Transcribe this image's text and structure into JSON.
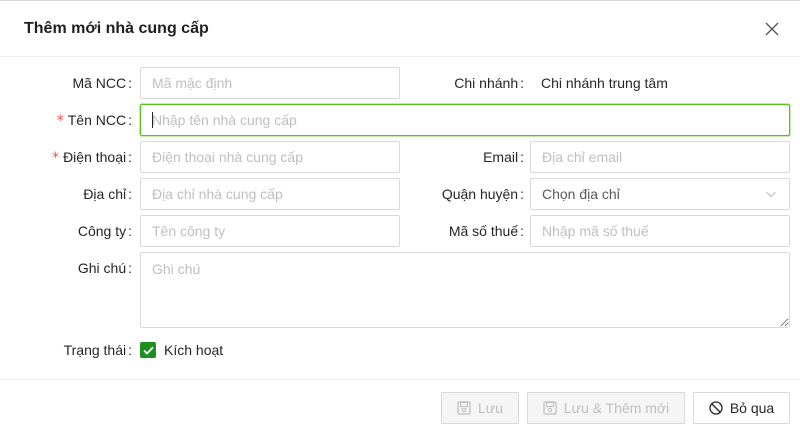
{
  "dialog": {
    "title": "Thêm mới nhà cung cấp"
  },
  "form": {
    "code": {
      "label": "Mã NCC",
      "placeholder": "Mã mặc định"
    },
    "branch": {
      "label": "Chi nhánh",
      "value": "Chi nhánh trung tâm"
    },
    "name": {
      "label": "Tên NCC",
      "required": "*",
      "placeholder": "Nhập tên nhà cung cấp"
    },
    "phone": {
      "label": "Điện thoại",
      "required": "*",
      "placeholder": "Điện thoại nhà cung cấp"
    },
    "email": {
      "label": "Email",
      "placeholder": "Địa chỉ email"
    },
    "address": {
      "label": "Địa chỉ",
      "placeholder": "Địa chỉ nhà cung cấp"
    },
    "district": {
      "label": "Quận huyện",
      "selected": "Chọn địa chỉ"
    },
    "company": {
      "label": "Công ty",
      "placeholder": "Tên công ty"
    },
    "tax": {
      "label": "Mã số thuế",
      "placeholder": "Nhập mã số thuế"
    },
    "note": {
      "label": "Ghi chú",
      "placeholder": "Ghi chú"
    },
    "status": {
      "label": "Trạng thái",
      "checkbox_label": "Kích hoạt",
      "checked": true
    }
  },
  "footer": {
    "save_label": "Lưu",
    "save_new_label": "Lưu & Thêm mới",
    "cancel_label": "Bỏ qua"
  },
  "icons": {
    "close": "close-icon",
    "save": "floppy-disk-icon",
    "cancel": "stop-circle-icon",
    "dropdown": "chevron-down-icon"
  },
  "colors": {
    "accent": "#1f8e1f",
    "focus_border": "#52c41a",
    "required": "#ff4d4f"
  }
}
